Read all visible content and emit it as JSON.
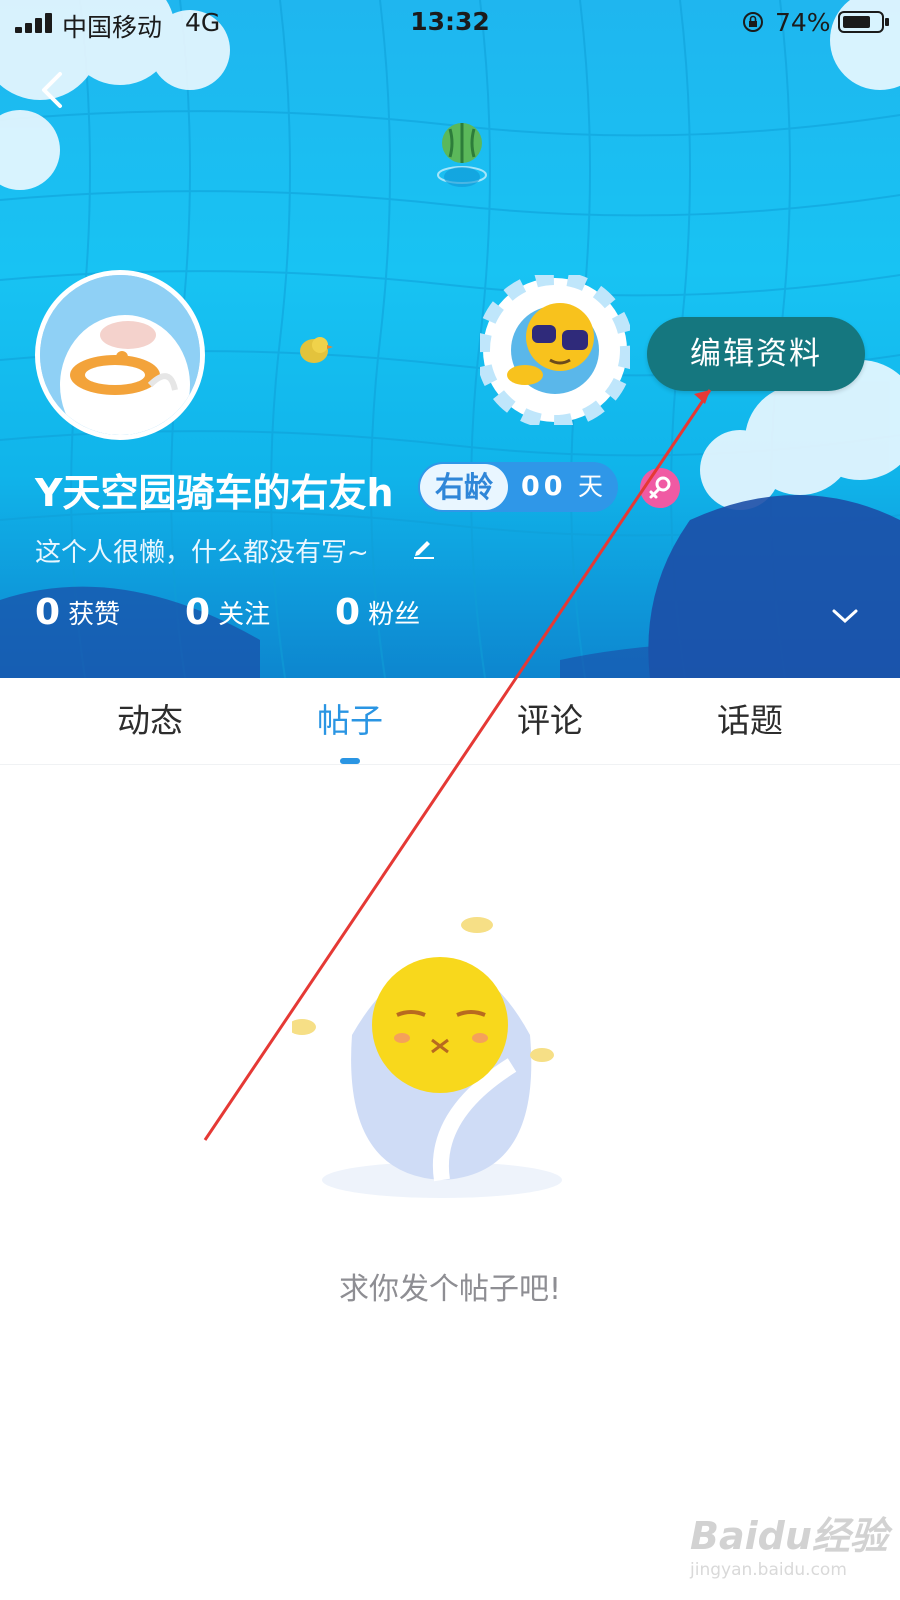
{
  "status_bar": {
    "carrier": "中国移动",
    "network": "4G",
    "time": "13:32",
    "battery_percent": "74%",
    "battery_level": 0.74,
    "icons": [
      "signal-icon",
      "rotation-lock-icon",
      "battery-icon"
    ]
  },
  "header": {
    "back_icon": "chevron-left-icon",
    "edit_profile_label": "编辑资料",
    "username": "Y天空园骑车的右友h",
    "age_badge": {
      "label": "右龄",
      "value": "00",
      "unit": "天"
    },
    "gender_icon": "female-icon",
    "bio": "这个人很懒，什么都没有写~",
    "bio_edit_icon": "pencil-icon",
    "stats": [
      {
        "count": "0",
        "label": "获赞"
      },
      {
        "count": "0",
        "label": "关注"
      },
      {
        "count": "0",
        "label": "粉丝"
      }
    ],
    "expand_icon": "chevron-down-icon"
  },
  "tabs": [
    {
      "label": "动态"
    },
    {
      "label": "帖子"
    },
    {
      "label": "评论"
    },
    {
      "label": "话题"
    }
  ],
  "active_tab": "帖子",
  "empty_state": {
    "message": "求你发个帖子吧!"
  },
  "watermark": {
    "text": "Baidu经验",
    "url": "jingyan.baidu.com"
  },
  "colors": {
    "header_blue": "#18c3f3",
    "accent_blue": "#2a95e3",
    "edit_button": "#15777f",
    "annotation_arrow": "#e53935",
    "gender_pink": "#f05aa3"
  }
}
